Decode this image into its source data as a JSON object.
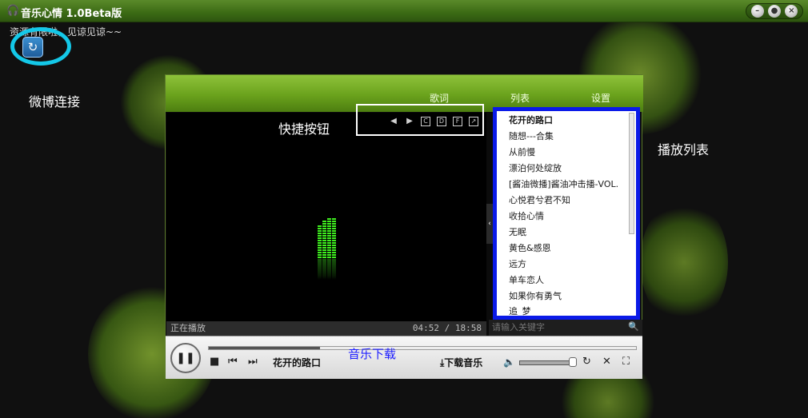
{
  "window": {
    "title": "音乐心情 1.0Beta版",
    "controls": {
      "minimize": "–",
      "restore": "●",
      "close": "×"
    }
  },
  "notice": "资源有限啦，见谅见谅~~",
  "weibo": {
    "button_glyph": "↻",
    "label": "微博连接"
  },
  "annotations": {
    "quick_buttons": "快捷按钮",
    "playlist": "播放列表",
    "download": "音乐下载"
  },
  "tabs": [
    {
      "label": "歌词"
    },
    {
      "label": "列表"
    },
    {
      "label": "设置"
    }
  ],
  "quick_buttons": [
    {
      "name": "prev",
      "glyph": "◀"
    },
    {
      "name": "next",
      "glyph": "▶"
    },
    {
      "name": "c",
      "glyph": "C"
    },
    {
      "name": "d",
      "glyph": "D"
    },
    {
      "name": "f",
      "glyph": "F"
    },
    {
      "name": "expand",
      "glyph": "↗"
    }
  ],
  "playlist": {
    "items": [
      "花开的路口",
      "随想---合集",
      "从前慢",
      "漂泊何处绽放",
      "[酱油微播]酱油冲击播-VOL.",
      "心悦君兮君不知",
      "收拾心情",
      "无眠",
      "黄色&感恩",
      "远方",
      "单车恋人",
      "如果你有勇气",
      "追_梦"
    ],
    "active_index": 0,
    "search_placeholder": "请输入关键字"
  },
  "status": {
    "left": "正在播放",
    "time": "04:52 / 18:58",
    "progress": 0.26
  },
  "player": {
    "play_glyph": "❚❚",
    "now_playing": "花开的路口",
    "download_label": "⤓下载音乐",
    "volume": 0.95
  },
  "colors": {
    "annotation_circle": "#14c8e8",
    "annotation_box": "#0a1ae8",
    "download_annot": "#1c1cff",
    "banner": "#7ab42a"
  }
}
